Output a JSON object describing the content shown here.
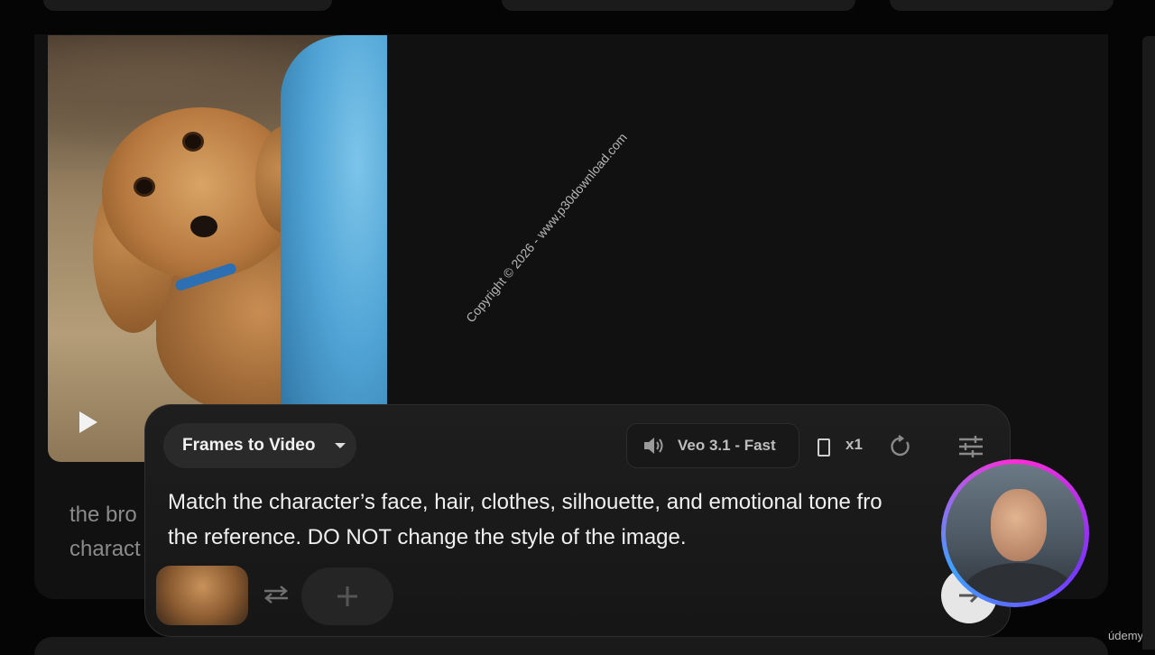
{
  "panel": {
    "mode_label": "Frames to Video",
    "model_label": "Veo 3.1 - Fast",
    "output_count": "x1",
    "prompt_line1": "Match the character’s face, hair, clothes, silhouette, and emotional tone fro",
    "prompt_line2": "the reference. DO NOT change the style of the image."
  },
  "card": {
    "caption_line1": "the bro",
    "caption_line2": "charact"
  },
  "overlay": {
    "watermark": "Copyright © 2026 - www.p30download.com",
    "brand": "údemy"
  },
  "icons": {
    "play": "play-icon",
    "mode_dropdown": "chevron-down-icon",
    "speaker": "speaker-icon",
    "aspect": "portrait-aspect-icon",
    "refresh": "refresh-icon",
    "settings": "sliders-icon",
    "swap": "swap-arrows-icon",
    "add": "plus-icon",
    "send": "arrow-right-icon"
  },
  "colors": {
    "background": "#050505",
    "panel": "#1e1e1e",
    "webcam_ring": "#ff2bd6"
  }
}
